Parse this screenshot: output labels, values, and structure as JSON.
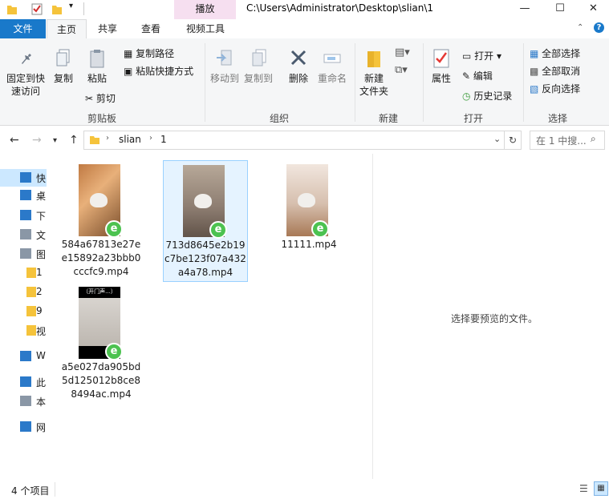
{
  "window": {
    "context_tab": "播放",
    "title": "C:\\Users\\Administrator\\Desktop\\slian\\1",
    "controls": {
      "minimize": "—",
      "maximize": "☐",
      "close": "✕"
    }
  },
  "ribbon_tabs": {
    "file": "文件",
    "home": "主页",
    "share": "共享",
    "view": "查看",
    "video_tools": "视频工具"
  },
  "ribbon": {
    "clipboard": {
      "pin": "固定到快\n速访问",
      "copy": "复制",
      "paste": "粘贴",
      "copy_path": "复制路径",
      "paste_shortcut": "粘贴快捷方式",
      "cut": "剪切",
      "label": "剪贴板"
    },
    "organize": {
      "move_to": "移动到",
      "copy_to": "复制到",
      "delete": "删除",
      "rename": "重命名",
      "label": "组织"
    },
    "new": {
      "new_folder": "新建\n文件夹",
      "label": "新建"
    },
    "open": {
      "properties": "属性",
      "open": "打开",
      "edit": "编辑",
      "history": "历史记录",
      "label": "打开"
    },
    "select": {
      "select_all": "全部选择",
      "select_none": "全部取消",
      "invert": "反向选择",
      "label": "选择"
    }
  },
  "address": {
    "crumbs": [
      "slian",
      "1"
    ],
    "search_placeholder": "在 1 中搜..."
  },
  "nav_pane": {
    "items": [
      {
        "label": "快",
        "icon": "star-icon"
      },
      {
        "label": "桌",
        "icon": "desktop-icon"
      },
      {
        "label": "下",
        "icon": "download-icon"
      },
      {
        "label": "文",
        "icon": "document-icon"
      },
      {
        "label": "图",
        "icon": "pictures-icon"
      },
      {
        "label": "1",
        "icon": "folder-icon"
      },
      {
        "label": "2",
        "icon": "folder-icon"
      },
      {
        "label": "9",
        "icon": "folder-icon"
      },
      {
        "label": "视",
        "icon": "folder-icon"
      },
      {
        "label": "W",
        "icon": "onedrive-icon"
      },
      {
        "label": "此",
        "icon": "pc-icon"
      },
      {
        "label": "本",
        "icon": "drive-icon"
      },
      {
        "label": "网",
        "icon": "network-icon"
      }
    ]
  },
  "files": [
    {
      "name": "584a67813e27ee15892a23bbb0cccfc9.mp4"
    },
    {
      "name": "713d8645e2b19c7be123f07a432a4a78.mp4"
    },
    {
      "name": "11111.mp4"
    },
    {
      "name": "a5e027da905bd5d125012b8ce88494ac.mp4",
      "overlay_text": "（开门声...）"
    }
  ],
  "preview_text": "选择要预览的文件。",
  "status": {
    "count": "4 个项目"
  },
  "colors": {
    "accent": "#1979ca",
    "context_tab": "#f6dff0",
    "selection": "#e5f3ff",
    "badge": "#4cc250"
  }
}
